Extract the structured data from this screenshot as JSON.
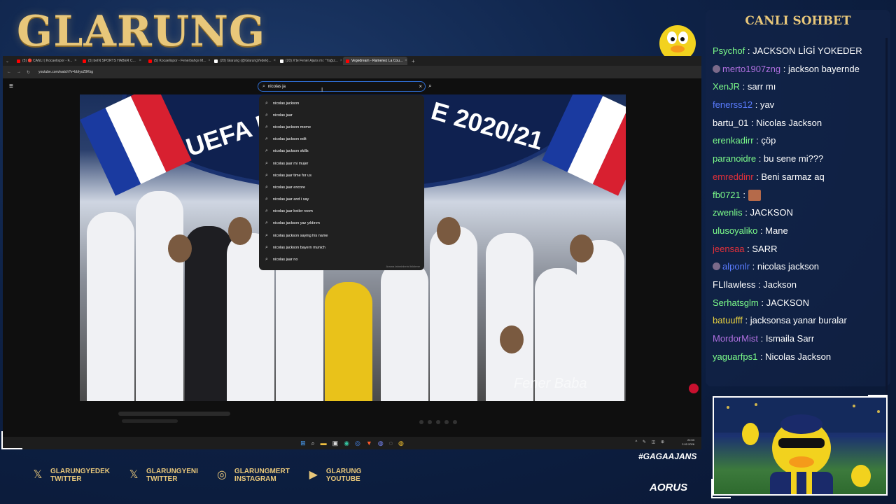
{
  "overlay": {
    "logo": "GLARUNG",
    "hashtag": "#GAGAAJANS",
    "sponsor": "AORUS",
    "gaga_badge": "gaga",
    "socials": [
      {
        "icon": "x-icon",
        "line1": "GLARUNGYEDEK",
        "line2": "TWITTER"
      },
      {
        "icon": "x-icon",
        "line1": "GLARUNGYENI",
        "line2": "TWITTER"
      },
      {
        "icon": "instagram-icon",
        "line1": "GLARUNGMERT",
        "line2": "INSTAGRAM"
      },
      {
        "icon": "youtube-icon",
        "line1": "GLARUNG",
        "line2": "YOUTUBE"
      }
    ]
  },
  "browser": {
    "tabs": [
      {
        "label": "(5) 🔴 CANLI | Kocaelispor - F...",
        "color": "#ff0000",
        "active": false
      },
      {
        "label": "(5) beIN SPORTS HABER C...",
        "color": "#ff0000",
        "active": false
      },
      {
        "label": "(5) Kocaelispor - Fenerbahçe M...",
        "color": "#ff0000",
        "active": false
      },
      {
        "label": "(20) Glarung (@GlarungYedek)...",
        "color": "#ffffff",
        "active": false
      },
      {
        "label": "(20) X'te Fener Ajans mı: \"Yağız...",
        "color": "#ffffff",
        "active": false
      },
      {
        "label": "Vegedream - Ramenez La Cou...",
        "color": "#ff0000",
        "active": true
      }
    ],
    "url": "youtube.com/watch?v=bbIyoZ9Kkg"
  },
  "youtube": {
    "search_query": "nicolas ja",
    "suggestions": [
      "nicolas jackson",
      "nicolas jaar",
      "nicolas jackson meme",
      "nicolas jackson edit",
      "nicolas jackson skills",
      "nicolas jaar mi mujer",
      "nicolas jaar time for us",
      "nicolas jaar encore",
      "nicolas jaar and i say",
      "nicolas jaar boiler room",
      "nicolas jackson yaz yıldırım",
      "nicolas jackson saying his name",
      "nicolas jackson bayern munich",
      "nicolas jaar no"
    ],
    "suggest_footer": "Arama tahminlerini bildirme",
    "video": {
      "banner_left": "UEFA N",
      "banner_right": "E 2020/21",
      "watermark": "Fener Baba"
    }
  },
  "taskbar": {
    "time": "22:53",
    "date": "2.02.2026"
  },
  "chat": {
    "title": "CANLI SOHBET",
    "messages": [
      {
        "user": "Psychof",
        "color": "#7CFC8A",
        "text": "JACKSON LİGİ YOKEDER",
        "badge": false
      },
      {
        "user": "merto1907zng",
        "color": "#b070e0",
        "text": "jackson bayernde",
        "badge": true
      },
      {
        "user": "XenJR",
        "color": "#7CFC8A",
        "text": "sarr mı",
        "badge": false
      },
      {
        "user": "fenerss12",
        "color": "#5a7cff",
        "text": "yav",
        "badge": false
      },
      {
        "user": "bartu_01",
        "color": "#ffffff",
        "text": "Nicolas Jackson",
        "badge": false
      },
      {
        "user": "erenkadirr",
        "color": "#7CFC8A",
        "text": "çöp",
        "badge": false
      },
      {
        "user": "paranoidre",
        "color": "#7CFC8A",
        "text": "bu sene mi???",
        "badge": false
      },
      {
        "user": "emreddinr",
        "color": "#e0303a",
        "text": "Beni sarmaz aq",
        "badge": false
      },
      {
        "user": "fb0721",
        "color": "#7CFC8A",
        "text": "",
        "badge": false,
        "emote": true
      },
      {
        "user": "zwenlis",
        "color": "#7CFC8A",
        "text": "JACKSON",
        "badge": false
      },
      {
        "user": "ulusoyaliko",
        "color": "#7CFC8A",
        "text": "Mane",
        "badge": false
      },
      {
        "user": "jeensaa",
        "color": "#e0303a",
        "text": "SARR",
        "badge": false
      },
      {
        "user": "alponlr",
        "color": "#5a7cff",
        "text": "nicolas jackson",
        "badge": true
      },
      {
        "user": "FLIlawless",
        "color": "#ffffff",
        "text": "Jackson",
        "badge": false
      },
      {
        "user": "Serhatsglm",
        "color": "#7CFC8A",
        "text": "JACKSON",
        "badge": false
      },
      {
        "user": "batuufff",
        "color": "#e8d040",
        "text": "jacksonsa yanar buralar",
        "badge": false
      },
      {
        "user": "MordorMist",
        "color": "#b070e0",
        "text": "Ismaila Sarr",
        "badge": false
      },
      {
        "user": "yaguarfps1",
        "color": "#7CFC8A",
        "text": "Nicolas Jackson",
        "badge": false
      }
    ]
  }
}
